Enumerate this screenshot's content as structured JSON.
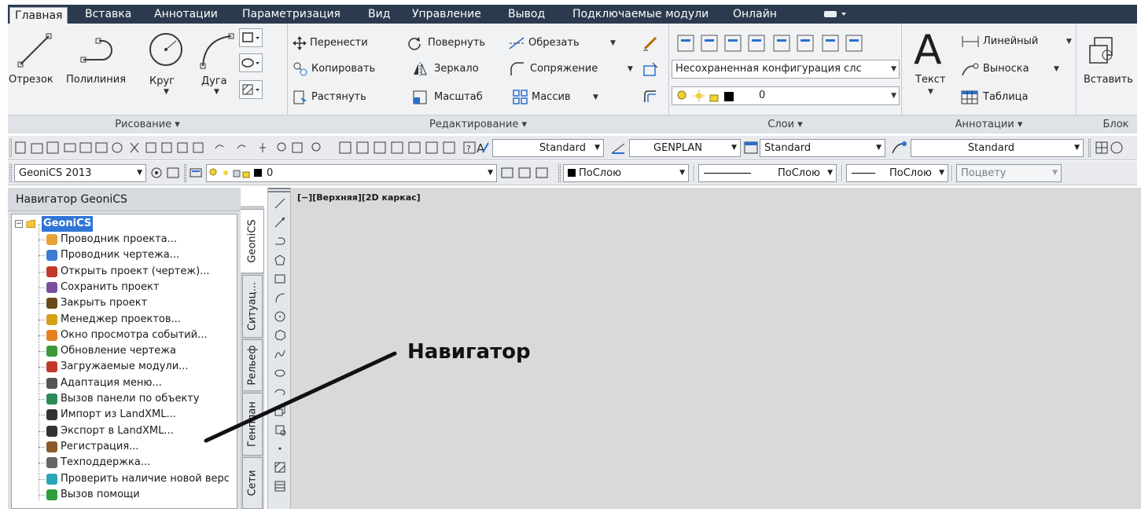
{
  "ribbon_tabs": [
    "Главная",
    "Вставка",
    "Аннотации",
    "Параметризация",
    "Вид",
    "Управление",
    "Вывод",
    "Подключаемые модули",
    "Онлайн"
  ],
  "draw_panel": {
    "title": "Рисование ▾",
    "tools": [
      "Отрезок",
      "Полилиния",
      "Круг",
      "Дуга"
    ]
  },
  "modify_panel": {
    "title": "Редактирование ▾",
    "tools": [
      "Перенести",
      "Повернуть",
      "Обрезать",
      "Копировать",
      "Зеркало",
      "Сопряжение",
      "Растянуть",
      "Масштаб",
      "Массив"
    ]
  },
  "layers_panel": {
    "title": "Слои ▾",
    "layer_state": "Несохраненная конфигурация слс",
    "current_layer": "0"
  },
  "annotations_panel": {
    "title": "Аннотации ▾",
    "text_label": "Текст",
    "tools": [
      "Линейный",
      "Выноска",
      "Таблица"
    ]
  },
  "block_panel": {
    "title": "Блок",
    "insert_label": "Вставить"
  },
  "standard_toolbar": {
    "text_style": "Standard",
    "dim_style": "GENPLAN",
    "table_style": "Standard",
    "multileader_style": "Standard"
  },
  "properties_toolbar": {
    "workspace": "GeoniCS 2013",
    "layer": "0",
    "color": "ПоСлою",
    "linetype": "ПоСлою",
    "lineweight": "ПоСлою",
    "plotstyle": "Поцвету"
  },
  "navigator": {
    "title": "Навигатор GeoniCS",
    "root": "GeoniCS",
    "items": [
      "Проводник проекта...",
      "Проводник чертежа...",
      "Открыть проект (чертеж)...",
      "Сохранить проект",
      "Закрыть проект",
      "Менеджер проектов...",
      "Окно просмотра событий...",
      "Обновление чертежа",
      "Загружаемые модули...",
      "Адаптация меню...",
      "Вызов панели по объекту",
      "Импорт из LandXML...",
      "Экспорт в LandXML...",
      "Регистрация...",
      "Техподдержка...",
      "Проверить наличие новой верс",
      "Вызов помощи"
    ],
    "vertical_tabs": [
      "GeoniCS",
      "Ситуац...",
      "Рельеф",
      "Генплан",
      "Сети"
    ]
  },
  "viewport_label": "[−][Верхняя][2D каркас]",
  "annotation": "Навигатор",
  "colors": {
    "tabbar": "#2b3a4e",
    "ribbon": "#f1f2f4",
    "canvas": "#d9d9d9",
    "selection": "#3076d6"
  }
}
